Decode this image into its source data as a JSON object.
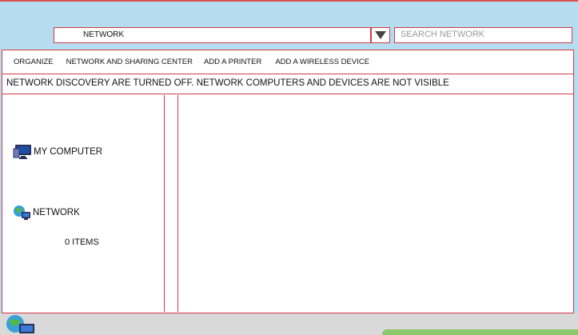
{
  "address_bar": {
    "path": "NETWORK",
    "dropdown_icon": "triangle-down-icon"
  },
  "search": {
    "placeholder": "SEARCH NETWORK"
  },
  "toolbar": {
    "items": [
      {
        "label": "ORGANIZE"
      },
      {
        "label": "NETWORK AND SHARING CENTER"
      },
      {
        "label": "ADD A PRINTER"
      },
      {
        "label": "ADD A WIRELESS DEVICE"
      }
    ]
  },
  "info_bar": {
    "message": "NETWORK DISCOVERY ARE TURNED OFF. NETWORK COMPUTERS AND DEVICES ARE NOT VISIBLE"
  },
  "nav_pane": {
    "items": [
      {
        "label": "MY COMPUTER",
        "icon": "computer-icon"
      },
      {
        "label": "NETWORK",
        "icon": "network-icon"
      }
    ]
  },
  "status_bar": {
    "item_count": "0 ITEMS",
    "icon": "network-icon"
  },
  "colors": {
    "background": "#b6dcef",
    "border_accent": "#cf3d47",
    "status_bar": "#d9d9d9",
    "corner_accent": "#8cc86c"
  }
}
